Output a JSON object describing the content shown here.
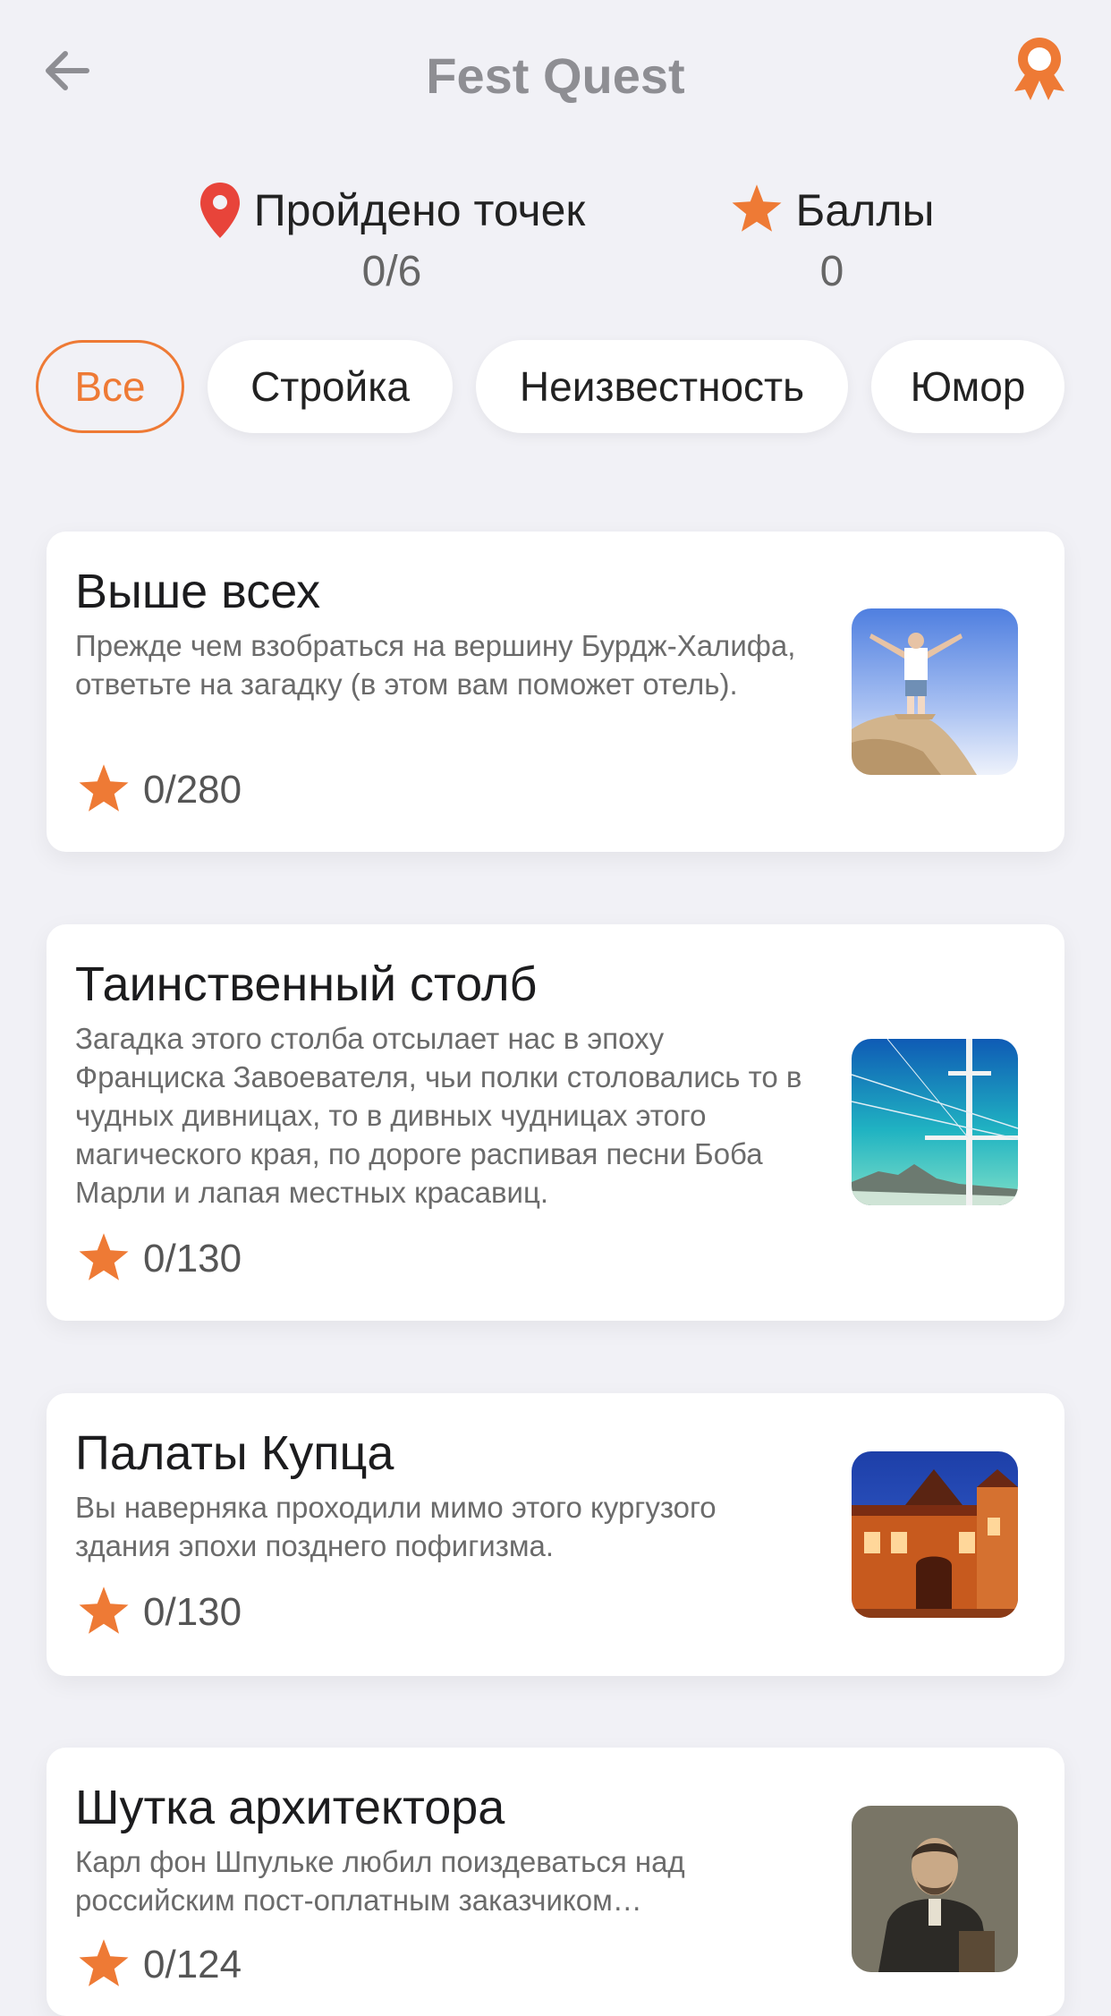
{
  "header": {
    "title": "Fest Quest",
    "back_icon": "arrow-left-icon",
    "award_icon": "award-ribbon-icon"
  },
  "stats": {
    "points_label": "Пройдено точек",
    "points_value": "0/6",
    "score_label": "Баллы",
    "score_value": "0"
  },
  "filters": [
    {
      "label": "Все",
      "active": true
    },
    {
      "label": "Стройка",
      "active": false
    },
    {
      "label": "Неизвестность",
      "active": false
    },
    {
      "label": "Юмор",
      "active": false
    }
  ],
  "quests": [
    {
      "title": "Выше всех",
      "description": "Прежде чем взобраться на вершину Бурдж-Халифа, ответьте на загадку (в этом вам поможет отель).",
      "points": "0/280"
    },
    {
      "title": "Таинственный столб",
      "description": "Загадка этого столба отсылает нас  в эпоху Франциска Завоевателя, чьи полки столовались то в чудных дивницах, то в дивных чудницах этого магического края, по дороге распивая песни Боба Марли и лапая местных красавиц.",
      "points": "0/130"
    },
    {
      "title": "Палаты Купца",
      "description": "Вы наверняка проходили мимо этого кургузого здания эпохи позднего пофигизма.",
      "points": "0/130"
    },
    {
      "title": "Шутка архитектора",
      "description": "Карл фон Шпульке любил поиздеваться над российским пост-оплатным заказчиком…",
      "points": "0/124"
    }
  ],
  "colors": {
    "accent": "#ee7a35",
    "pin": "#e8443a",
    "background": "#f1f1f6"
  }
}
